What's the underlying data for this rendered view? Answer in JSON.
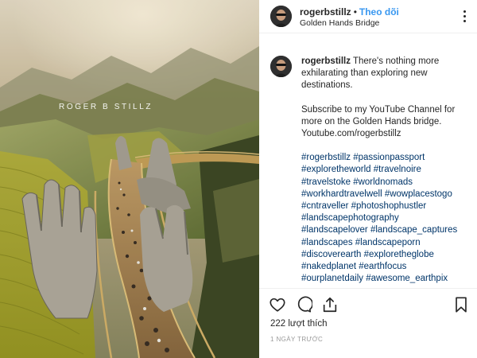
{
  "photo": {
    "alt_semantic": "golden-hands-bridge-photo",
    "watermark": "ROGER B STILLZ"
  },
  "header": {
    "username": "rogerbstillz",
    "separator": "•",
    "follow_label": "Theo dõi",
    "location": "Golden Hands Bridge"
  },
  "caption": {
    "username": "rogerbstillz",
    "text_1": "There's nothing more exhilarating than exploring new destinations.",
    "text_2": "Subscribe to my YouTube Channel for more on the Golden Hands bridge.",
    "link": "Youtube.com/rogerbstillz",
    "hashtags": [
      "#rogerbstillz #passionpassport",
      "#exploretheworld #travelnoire",
      "#travelstoke #worldnomads",
      "#workhardtravelwell #wowplacestogo",
      "#cntraveller #photoshophustler",
      "#landscapephotography",
      "#landscapelover #landscape_captures",
      "#landscapes #landscapeporn",
      "#discoverearth #exploretheglobe",
      "#nakedplanet #earthfocus",
      "#ourplanetdaily #awesome_earthpix"
    ]
  },
  "actions": {
    "like_icon": "heart-icon",
    "comment_icon": "comment-icon",
    "share_icon": "share-icon",
    "save_icon": "bookmark-icon"
  },
  "likes": "222 lượt thích",
  "timestamp": "1 NGÀY TRƯỚC",
  "colors": {
    "follow": "#3897f0",
    "hashtag": "#003569",
    "text": "#262626",
    "muted": "#999999",
    "border": "#efefef"
  }
}
